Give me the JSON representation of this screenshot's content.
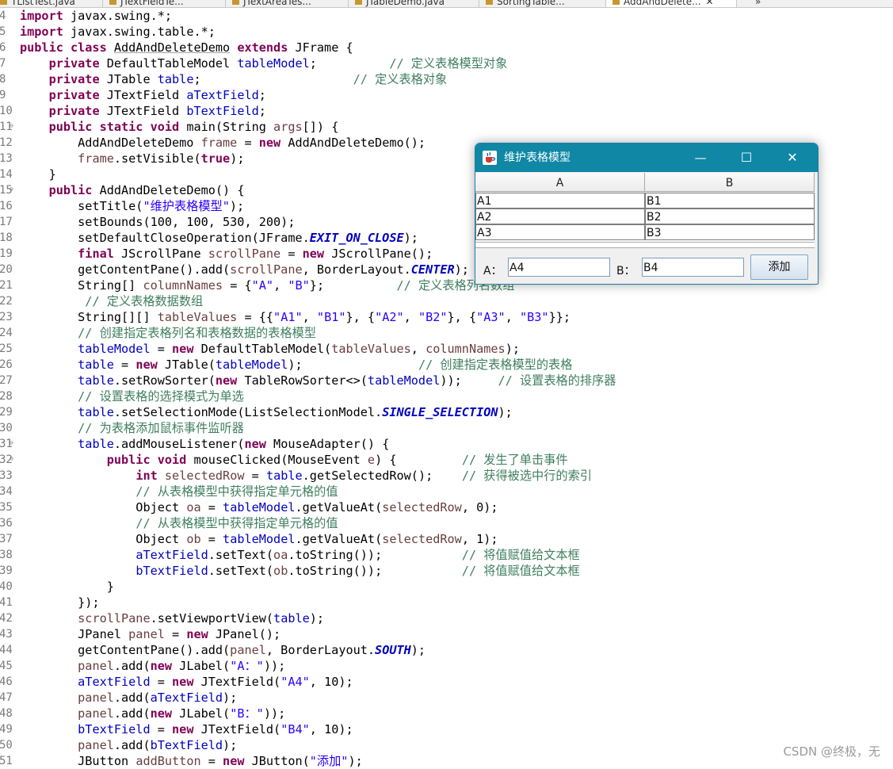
{
  "tabs": [
    {
      "label": "TListTest.java"
    },
    {
      "label": "JTextFieldTe..."
    },
    {
      "label": "JTextAreaTes..."
    },
    {
      "label": "JTableDemo.java"
    },
    {
      "label": "SortingTable..."
    },
    {
      "label": "AddAndDelete..."
    }
  ],
  "tab_close": "✕",
  "tab_overflow": "»",
  "code_lines": [
    {
      "n": "4",
      "tokens": [
        [
          "kw",
          "import"
        ],
        [
          "tx",
          " javax.swing.*;"
        ]
      ]
    },
    {
      "n": "5",
      "tokens": [
        [
          "kw",
          "import"
        ],
        [
          "tx",
          " javax.swing.table.*;"
        ]
      ]
    },
    {
      "n": "6",
      "tokens": [
        [
          "kw",
          "public class "
        ],
        [
          "uline",
          "AddAndDeleteDemo"
        ],
        [
          "kw",
          " extends"
        ],
        [
          "tx",
          " JFrame {"
        ]
      ]
    },
    {
      "n": "7",
      "tokens": [
        [
          "tx",
          "    "
        ],
        [
          "kw",
          "private"
        ],
        [
          "tx",
          " DefaultTableModel "
        ],
        [
          "fld",
          "tableModel"
        ],
        [
          "tx",
          ";          "
        ],
        [
          "cmt",
          "// 定义表格模型对象"
        ]
      ]
    },
    {
      "n": "8",
      "tokens": [
        [
          "tx",
          "    "
        ],
        [
          "kw",
          "private"
        ],
        [
          "tx",
          " JTable "
        ],
        [
          "fld",
          "table"
        ],
        [
          "tx",
          ";                     "
        ],
        [
          "cmt",
          "// 定义表格对象"
        ]
      ]
    },
    {
      "n": "9",
      "tokens": [
        [
          "tx",
          "    "
        ],
        [
          "kw",
          "private"
        ],
        [
          "tx",
          " JTextField "
        ],
        [
          "fld",
          "aTextField"
        ],
        [
          "tx",
          ";"
        ]
      ]
    },
    {
      "n": "10",
      "tokens": [
        [
          "tx",
          "    "
        ],
        [
          "kw",
          "private"
        ],
        [
          "tx",
          " JTextField "
        ],
        [
          "fld",
          "bTextField"
        ],
        [
          "tx",
          ";"
        ]
      ]
    },
    {
      "n": "11",
      "fold": true,
      "tokens": [
        [
          "tx",
          "    "
        ],
        [
          "kw",
          "public static void"
        ],
        [
          "tx",
          " main(String "
        ],
        [
          "var",
          "args"
        ],
        [
          "tx",
          "[]) {"
        ]
      ]
    },
    {
      "n": "12",
      "tokens": [
        [
          "tx",
          "        AddAndDeleteDemo "
        ],
        [
          "var",
          "frame"
        ],
        [
          "tx",
          " = "
        ],
        [
          "kw",
          "new"
        ],
        [
          "tx",
          " AddAndDeleteDemo();"
        ]
      ]
    },
    {
      "n": "13",
      "tokens": [
        [
          "tx",
          "        "
        ],
        [
          "var",
          "frame"
        ],
        [
          "tx",
          ".setVisible("
        ],
        [
          "kw",
          "true"
        ],
        [
          "tx",
          ");"
        ]
      ]
    },
    {
      "n": "14",
      "tokens": [
        [
          "tx",
          "    }"
        ]
      ]
    },
    {
      "n": "15",
      "fold": true,
      "tokens": [
        [
          "tx",
          "    "
        ],
        [
          "kw",
          "public"
        ],
        [
          "tx",
          " AddAndDeleteDemo() {"
        ]
      ]
    },
    {
      "n": "16",
      "tokens": [
        [
          "tx",
          "        setTitle("
        ],
        [
          "str",
          "\"维护表格模型\""
        ],
        [
          "tx",
          ");"
        ]
      ]
    },
    {
      "n": "17",
      "tokens": [
        [
          "tx",
          "        setBounds(100, 100, 530, 200);"
        ]
      ]
    },
    {
      "n": "18",
      "tokens": [
        [
          "tx",
          "        setDefaultCloseOperation(JFrame."
        ],
        [
          "sfld",
          "EXIT_ON_CLOSE"
        ],
        [
          "tx",
          ");"
        ]
      ]
    },
    {
      "n": "19",
      "tokens": [
        [
          "tx",
          "        "
        ],
        [
          "kw",
          "final"
        ],
        [
          "tx",
          " JScrollPane "
        ],
        [
          "var",
          "scrollPane"
        ],
        [
          "tx",
          " = "
        ],
        [
          "kw",
          "new"
        ],
        [
          "tx",
          " JScrollPane();"
        ]
      ]
    },
    {
      "n": "20",
      "tokens": [
        [
          "tx",
          "        getContentPane().add("
        ],
        [
          "var",
          "scrollPane"
        ],
        [
          "tx",
          ", BorderLayout."
        ],
        [
          "sfld",
          "CENTER"
        ],
        [
          "tx",
          ");"
        ]
      ]
    },
    {
      "n": "21",
      "tokens": [
        [
          "tx",
          "        String[] "
        ],
        [
          "var",
          "columnNames"
        ],
        [
          "tx",
          " = {"
        ],
        [
          "str",
          "\"A\""
        ],
        [
          "tx",
          ", "
        ],
        [
          "str",
          "\"B\""
        ],
        [
          "tx",
          "};          "
        ],
        [
          "cmt",
          "// 定义表格列名数组"
        ]
      ]
    },
    {
      "n": "22",
      "tokens": [
        [
          "tx",
          "         "
        ],
        [
          "cmt",
          "// 定义表格数据数组"
        ]
      ]
    },
    {
      "n": "23",
      "tokens": [
        [
          "tx",
          "        String[][] "
        ],
        [
          "var",
          "tableValues"
        ],
        [
          "tx",
          " = {{"
        ],
        [
          "str",
          "\"A1\""
        ],
        [
          "tx",
          ", "
        ],
        [
          "str",
          "\"B1\""
        ],
        [
          "tx",
          "}, {"
        ],
        [
          "str",
          "\"A2\""
        ],
        [
          "tx",
          ", "
        ],
        [
          "str",
          "\"B2\""
        ],
        [
          "tx",
          "}, {"
        ],
        [
          "str",
          "\"A3\""
        ],
        [
          "tx",
          ", "
        ],
        [
          "str",
          "\"B3\""
        ],
        [
          "tx",
          "}};"
        ]
      ]
    },
    {
      "n": "24",
      "tokens": [
        [
          "tx",
          "        "
        ],
        [
          "cmt",
          "// 创建指定表格列名和表格数据的表格模型"
        ]
      ]
    },
    {
      "n": "25",
      "tokens": [
        [
          "tx",
          "        "
        ],
        [
          "fld",
          "tableModel"
        ],
        [
          "tx",
          " = "
        ],
        [
          "kw",
          "new"
        ],
        [
          "tx",
          " DefaultTableModel("
        ],
        [
          "var",
          "tableValues"
        ],
        [
          "tx",
          ", "
        ],
        [
          "var",
          "columnNames"
        ],
        [
          "tx",
          ");"
        ]
      ]
    },
    {
      "n": "26",
      "tokens": [
        [
          "tx",
          "        "
        ],
        [
          "fld",
          "table"
        ],
        [
          "tx",
          " = "
        ],
        [
          "kw",
          "new"
        ],
        [
          "tx",
          " JTable("
        ],
        [
          "fld",
          "tableModel"
        ],
        [
          "tx",
          ");                "
        ],
        [
          "cmt",
          "// 创建指定表格模型的表格"
        ]
      ]
    },
    {
      "n": "27",
      "tokens": [
        [
          "tx",
          "        "
        ],
        [
          "fld",
          "table"
        ],
        [
          "tx",
          ".setRowSorter("
        ],
        [
          "kw",
          "new"
        ],
        [
          "tx",
          " TableRowSorter<>("
        ],
        [
          "fld",
          "tableModel"
        ],
        [
          "tx",
          "));     "
        ],
        [
          "cmt",
          "// 设置表格的排序器"
        ]
      ]
    },
    {
      "n": "28",
      "tokens": [
        [
          "tx",
          "        "
        ],
        [
          "cmt",
          "// 设置表格的选择模式为单选"
        ]
      ]
    },
    {
      "n": "29",
      "tokens": [
        [
          "tx",
          "        "
        ],
        [
          "fld",
          "table"
        ],
        [
          "tx",
          ".setSelectionMode(ListSelectionModel."
        ],
        [
          "sfld",
          "SINGLE_SELECTION"
        ],
        [
          "tx",
          ");"
        ]
      ]
    },
    {
      "n": "30",
      "tokens": [
        [
          "tx",
          "        "
        ],
        [
          "cmt",
          "// 为表格添加鼠标事件监听器"
        ]
      ]
    },
    {
      "n": "31",
      "fold": true,
      "tokens": [
        [
          "tx",
          "        "
        ],
        [
          "fld",
          "table"
        ],
        [
          "tx",
          ".addMouseListener("
        ],
        [
          "kw",
          "new"
        ],
        [
          "tx",
          " MouseAdapter() {"
        ]
      ]
    },
    {
      "n": "32",
      "fold": true,
      "tokens": [
        [
          "tx",
          "            "
        ],
        [
          "kw",
          "public void"
        ],
        [
          "tx",
          " mouseClicked(MouseEvent "
        ],
        [
          "var",
          "e"
        ],
        [
          "tx",
          ") {         "
        ],
        [
          "cmt",
          "// 发生了单击事件"
        ]
      ]
    },
    {
      "n": "33",
      "tokens": [
        [
          "tx",
          "                "
        ],
        [
          "kw",
          "int"
        ],
        [
          "tx",
          " "
        ],
        [
          "var",
          "selectedRow"
        ],
        [
          "tx",
          " = "
        ],
        [
          "fld",
          "table"
        ],
        [
          "tx",
          ".getSelectedRow();    "
        ],
        [
          "cmt",
          "// 获得被选中行的索引"
        ]
      ]
    },
    {
      "n": "34",
      "tokens": [
        [
          "tx",
          "                "
        ],
        [
          "cmt",
          "// 从表格模型中获得指定单元格的值"
        ]
      ]
    },
    {
      "n": "35",
      "tokens": [
        [
          "tx",
          "                Object "
        ],
        [
          "var",
          "oa"
        ],
        [
          "tx",
          " = "
        ],
        [
          "fld",
          "tableModel"
        ],
        [
          "tx",
          ".getValueAt("
        ],
        [
          "var",
          "selectedRow"
        ],
        [
          "tx",
          ", 0);"
        ]
      ]
    },
    {
      "n": "36",
      "tokens": [
        [
          "tx",
          "                "
        ],
        [
          "cmt",
          "// 从表格模型中获得指定单元格的值"
        ]
      ]
    },
    {
      "n": "37",
      "tokens": [
        [
          "tx",
          "                Object "
        ],
        [
          "var",
          "ob"
        ],
        [
          "tx",
          " = "
        ],
        [
          "fld",
          "tableModel"
        ],
        [
          "tx",
          ".getValueAt("
        ],
        [
          "var",
          "selectedRow"
        ],
        [
          "tx",
          ", 1);"
        ]
      ]
    },
    {
      "n": "38",
      "tokens": [
        [
          "tx",
          "                "
        ],
        [
          "fld",
          "aTextField"
        ],
        [
          "tx",
          ".setText("
        ],
        [
          "var",
          "oa"
        ],
        [
          "tx",
          ".toString());           "
        ],
        [
          "cmt",
          "// 将值赋值给文本框"
        ]
      ]
    },
    {
      "n": "39",
      "tokens": [
        [
          "tx",
          "                "
        ],
        [
          "fld",
          "bTextField"
        ],
        [
          "tx",
          ".setText("
        ],
        [
          "var",
          "ob"
        ],
        [
          "tx",
          ".toString());           "
        ],
        [
          "cmt",
          "// 将值赋值给文本框"
        ]
      ]
    },
    {
      "n": "40",
      "tokens": [
        [
          "tx",
          "            }"
        ]
      ]
    },
    {
      "n": "41",
      "tokens": [
        [
          "tx",
          "        });"
        ]
      ]
    },
    {
      "n": "42",
      "tokens": [
        [
          "tx",
          "        "
        ],
        [
          "var",
          "scrollPane"
        ],
        [
          "tx",
          ".setViewportView("
        ],
        [
          "fld",
          "table"
        ],
        [
          "tx",
          ");"
        ]
      ]
    },
    {
      "n": "43",
      "tokens": [
        [
          "tx",
          "        JPanel "
        ],
        [
          "var",
          "panel"
        ],
        [
          "tx",
          " = "
        ],
        [
          "kw",
          "new"
        ],
        [
          "tx",
          " JPanel();"
        ]
      ]
    },
    {
      "n": "44",
      "tokens": [
        [
          "tx",
          "        getContentPane().add("
        ],
        [
          "var",
          "panel"
        ],
        [
          "tx",
          ", BorderLayout."
        ],
        [
          "sfld",
          "SOUTH"
        ],
        [
          "tx",
          ");"
        ]
      ]
    },
    {
      "n": "45",
      "tokens": [
        [
          "tx",
          "        "
        ],
        [
          "var",
          "panel"
        ],
        [
          "tx",
          ".add("
        ],
        [
          "kw",
          "new"
        ],
        [
          "tx",
          " JLabel("
        ],
        [
          "str",
          "\"A：\""
        ],
        [
          "tx",
          "));"
        ]
      ]
    },
    {
      "n": "46",
      "tokens": [
        [
          "tx",
          "        "
        ],
        [
          "fld",
          "aTextField"
        ],
        [
          "tx",
          " = "
        ],
        [
          "kw",
          "new"
        ],
        [
          "tx",
          " JTextField("
        ],
        [
          "str",
          "\"A4\""
        ],
        [
          "tx",
          ", 10);"
        ]
      ]
    },
    {
      "n": "47",
      "tokens": [
        [
          "tx",
          "        "
        ],
        [
          "var",
          "panel"
        ],
        [
          "tx",
          ".add("
        ],
        [
          "fld",
          "aTextField"
        ],
        [
          "tx",
          ");"
        ]
      ]
    },
    {
      "n": "48",
      "tokens": [
        [
          "tx",
          "        "
        ],
        [
          "var",
          "panel"
        ],
        [
          "tx",
          ".add("
        ],
        [
          "kw",
          "new"
        ],
        [
          "tx",
          " JLabel("
        ],
        [
          "str",
          "\"B：\""
        ],
        [
          "tx",
          "));"
        ]
      ]
    },
    {
      "n": "49",
      "tokens": [
        [
          "tx",
          "        "
        ],
        [
          "fld",
          "bTextField"
        ],
        [
          "tx",
          " = "
        ],
        [
          "kw",
          "new"
        ],
        [
          "tx",
          " JTextField("
        ],
        [
          "str",
          "\"B4\""
        ],
        [
          "tx",
          ", 10);"
        ]
      ]
    },
    {
      "n": "50",
      "tokens": [
        [
          "tx",
          "        "
        ],
        [
          "var",
          "panel"
        ],
        [
          "tx",
          ".add("
        ],
        [
          "fld",
          "bTextField"
        ],
        [
          "tx",
          ");"
        ]
      ]
    },
    {
      "n": "51",
      "tokens": [
        [
          "tx",
          "        JButton "
        ],
        [
          "var",
          "addButton"
        ],
        [
          "tx",
          " = "
        ],
        [
          "kw",
          "new"
        ],
        [
          "tx",
          " JButton("
        ],
        [
          "str",
          "\"添加\""
        ],
        [
          "tx",
          ");"
        ]
      ]
    }
  ],
  "colors": {
    "keyword": "#7f0055",
    "field": "#0000c0",
    "string": "#2a00ff",
    "comment": "#3f7f5f",
    "local_var": "#6a3e3e",
    "titlebar": "#0f87a5"
  },
  "window": {
    "title": "维护表格模型",
    "icon": "java-coffee-cup-icon",
    "controls": {
      "minimize": "—",
      "maximize": "☐",
      "close": "✕"
    },
    "columns": [
      "A",
      "B"
    ],
    "rows": [
      [
        "A1",
        "B1"
      ],
      [
        "A2",
        "B2"
      ],
      [
        "A3",
        "B3"
      ]
    ],
    "label_a": "A：",
    "label_b": "B：",
    "field_a": "A4",
    "field_b": "B4",
    "add_button": "添加"
  },
  "watermark": "CSDN @终极，无"
}
